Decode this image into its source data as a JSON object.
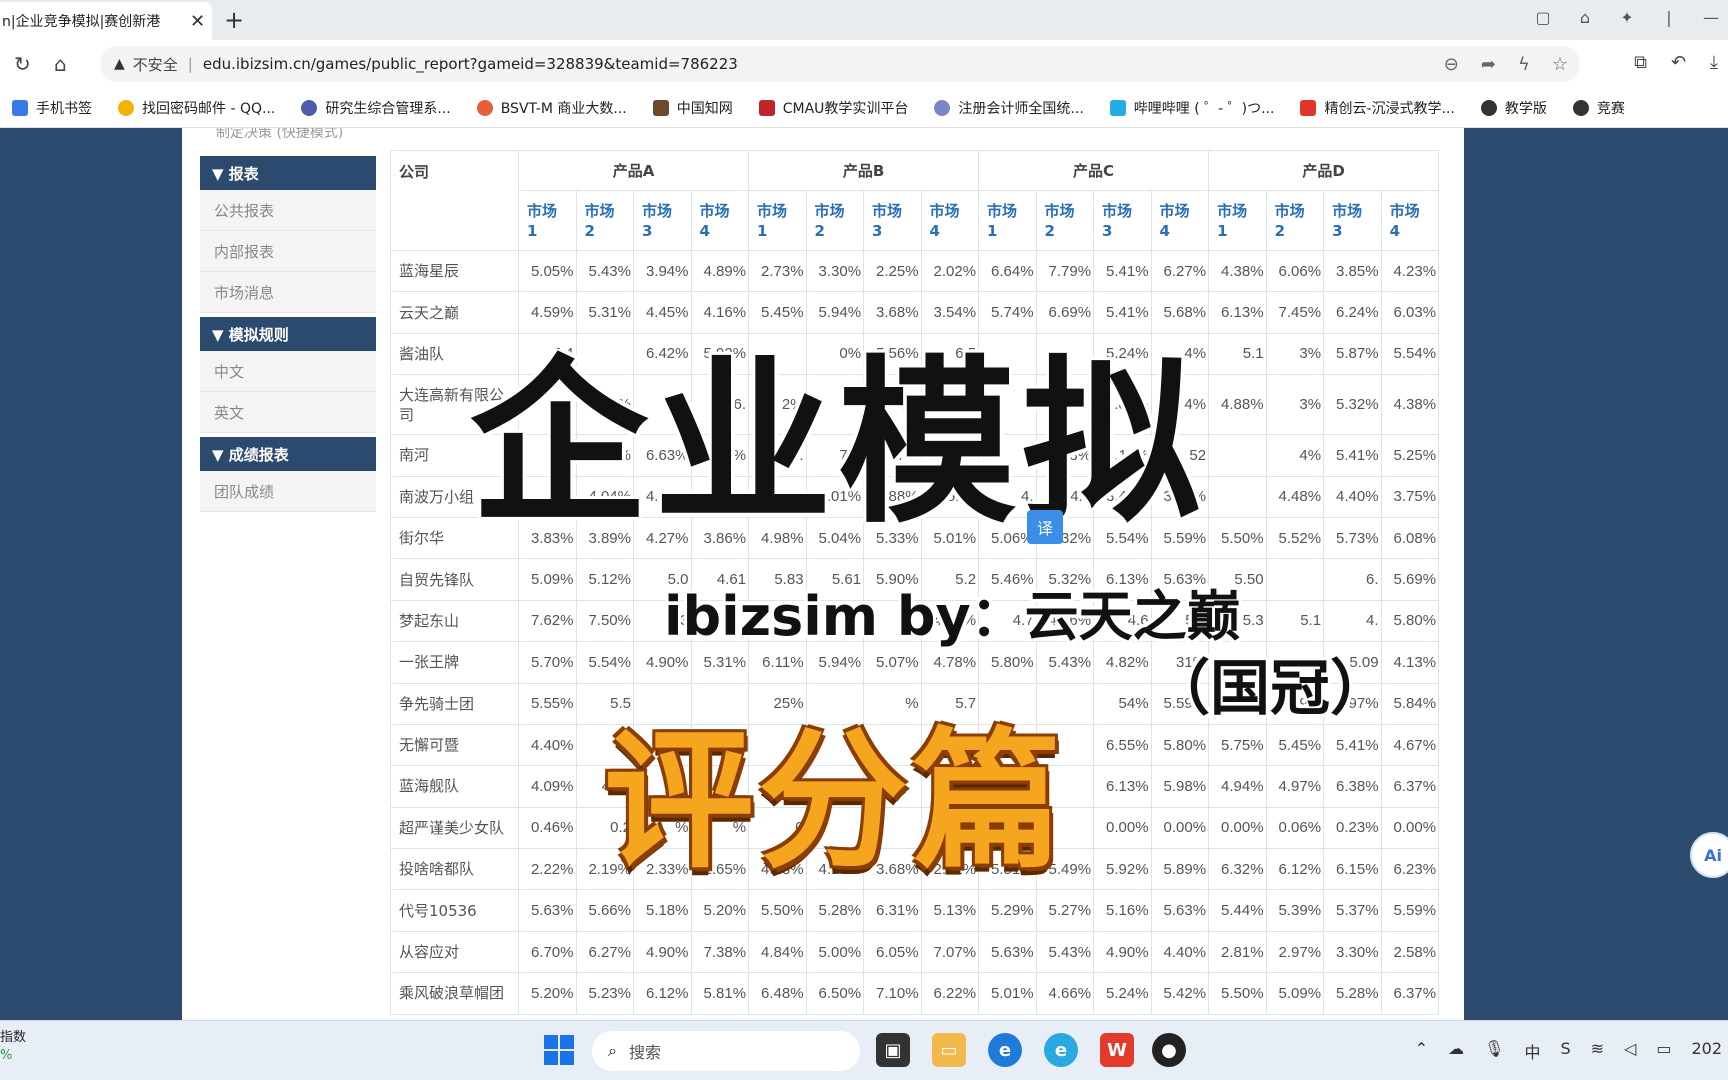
{
  "browser": {
    "tab_title": "n|企业竞争模拟|赛创新港",
    "tab_close": "✕",
    "new_tab": "+",
    "insecure_label": "不安全",
    "url": "edu.ibizsim.cn/games/public_report?gameid=328839&teamid=786223",
    "bookmarks": [
      "手机书签",
      "找回密码邮件 - QQ...",
      "研究生综合管理系...",
      "BSVT-M 商业大数...",
      "中国知网",
      "CMAU教学实训平台",
      "注册会计师全国统...",
      "哔哩哔哩 ( ゜- ゜)つ...",
      "精创云-沉浸式教学...",
      "教学版",
      "竞赛"
    ]
  },
  "sidebar": {
    "cut_item": "制定决策 (快捷模式)",
    "sections": [
      {
        "title": "▼ 报表",
        "items": [
          "公共报表",
          "内部报表",
          "市场消息"
        ]
      },
      {
        "title": "▼ 模拟规则",
        "items": [
          "中文",
          "英文"
        ]
      },
      {
        "title": "▼ 成绩报表",
        "items": [
          "团队成绩"
        ]
      }
    ]
  },
  "table": {
    "corner": "公司",
    "products": [
      "产品A",
      "产品B",
      "产品C",
      "产品D"
    ],
    "markets": [
      "市场\n1",
      "市场\n2",
      "市场\n3",
      "市场\n4"
    ],
    "rows": [
      {
        "company": "蓝海星辰",
        "values": [
          "5.05%",
          "5.43%",
          "3.94%",
          "4.89%",
          "2.73%",
          "3.30%",
          "2.25%",
          "2.02%",
          "6.64%",
          "7.79%",
          "5.41%",
          "6.27%",
          "4.38%",
          "6.06%",
          "3.85%",
          "4.23%"
        ]
      },
      {
        "company": "云天之巅",
        "values": [
          "4.59%",
          "5.31%",
          "4.45%",
          "4.16%",
          "5.45%",
          "5.94%",
          "3.68%",
          "3.54%",
          "5.74%",
          "6.69%",
          "5.41%",
          "5.68%",
          "6.13%",
          "7.45%",
          "6.24%",
          "6.03%"
        ]
      },
      {
        "company": "酱油队",
        "values": [
          "5.4",
          "",
          "6.42%",
          "5.92%",
          "",
          "0%",
          "5.56%",
          "6.5",
          "",
          "",
          "5.24%",
          "4%",
          "5.1",
          "3%",
          "5.87%",
          "5.54%"
        ]
      },
      {
        "company": "大连高新有限公司",
        "values": [
          "2%",
          "5%",
          "7%",
          "6.",
          "2%",
          "",
          "6.43%",
          "",
          "",
          "",
          "4.86%",
          "4%",
          "4.88%",
          "3%",
          "5.32%",
          "4.38%"
        ]
      },
      {
        "company": "南河",
        "values": [
          "%",
          "9%",
          "6.63%",
          "6.43%",
          "6.",
          "7%",
          "7.17%",
          "1",
          "3",
          "3%",
          "4.18%",
          "52",
          "",
          "4%",
          "5.41%",
          "5.25%"
        ]
      },
      {
        "company": "南波万小组",
        "values": [
          "",
          "4.04%",
          "4.69%",
          "5.",
          "4.09%",
          "4.01%",
          "4.88%",
          "5.71",
          "4.",
          "4.2",
          "3.48%",
          "3.23%",
          "",
          "4.48%",
          "4.40%",
          "3.75%"
        ]
      },
      {
        "company": "街尔华",
        "values": [
          "3.83%",
          "3.89%",
          "4.27%",
          "3.86%",
          "4.98%",
          "5.04%",
          "5.33%",
          "5.01%",
          "5.06%",
          "5.32%",
          "5.54%",
          "5.59%",
          "5.50%",
          "5.52%",
          "5.73%",
          "6.08%"
        ]
      },
      {
        "company": "自贸先锋队",
        "values": [
          "5.09%",
          "5.12%",
          "5.0",
          "4.61",
          "5.83",
          "5.61",
          "5.90%",
          "5.2",
          "5.46%",
          "5.32%",
          "6.13%",
          "5.63%",
          "5.50",
          "",
          "6.",
          "5.69%"
        ]
      },
      {
        "company": "梦起东山",
        "values": [
          "7.62%",
          "7.50%",
          "6.3",
          "",
          "",
          "",
          "",
          "4.60%",
          "4.7",
          "4.66%",
          "4.6",
          "5.2",
          "5.3",
          "5.1",
          "4.",
          "5.80%"
        ]
      },
      {
        "company": "一张王牌",
        "values": [
          "5.70%",
          "5.54%",
          "4.90%",
          "5.31%",
          "6.11%",
          "5.94%",
          "5.07%",
          "4.78%",
          "5.80%",
          "5.43%",
          "4.82%",
          "31%",
          "",
          "",
          "5.09",
          "4.13%"
        ]
      },
      {
        "company": "争先骑士团",
        "values": [
          "5.55%",
          "5.5",
          "",
          "",
          "25%",
          "",
          "%",
          "5.7",
          "",
          "",
          "54%",
          "5.59%",
          "4.94%",
          "4.79%",
          "4.97%",
          "5.84%"
        ]
      },
      {
        "company": "无懈可暨",
        "values": [
          "4.40%",
          "4",
          "",
          "",
          "",
          "",
          "",
          "",
          "",
          "",
          "6.55%",
          "5.80%",
          "5.75%",
          "5.45%",
          "5.41%",
          "4.67%"
        ]
      },
      {
        "company": "蓝海舰队",
        "values": [
          "4.09%",
          "4.12",
          "",
          "",
          "",
          "",
          "",
          "9.5",
          "",
          "",
          "6.13%",
          "5.98%",
          "4.94%",
          "4.97%",
          "6.38%",
          "6.37%"
        ]
      },
      {
        "company": "超严谨美少女队",
        "values": [
          "0.46%",
          "0.2",
          "%",
          "%",
          "0",
          "",
          "",
          "",
          "",
          "",
          "0.00%",
          "0.00%",
          "0.00%",
          "0.06%",
          "0.23%",
          "0.00%"
        ]
      },
      {
        "company": "投啥啥都队",
        "values": [
          "2.22%",
          "2.19%",
          "2.33%",
          "1.65%",
          "4.28%",
          "4.19%",
          "3.68%",
          "2.91%",
          "5.51%",
          "5.49%",
          "5.92%",
          "5.89%",
          "6.32%",
          "6.12%",
          "6.15%",
          "6.23%"
        ]
      },
      {
        "company": "代号10536",
        "values": [
          "5.63%",
          "5.66%",
          "5.18%",
          "5.20%",
          "5.50%",
          "5.28%",
          "6.31%",
          "5.13%",
          "5.29%",
          "5.27%",
          "5.16%",
          "5.63%",
          "5.44%",
          "5.39%",
          "5.37%",
          "5.59%"
        ]
      },
      {
        "company": "从容应对",
        "values": [
          "6.70%",
          "6.27%",
          "4.90%",
          "7.38%",
          "4.84%",
          "5.00%",
          "6.05%",
          "7.07%",
          "5.63%",
          "5.43%",
          "4.90%",
          "4.40%",
          "2.81%",
          "2.97%",
          "3.30%",
          "2.58%"
        ]
      },
      {
        "company": "乘风破浪草帽团",
        "values": [
          "5.20%",
          "5.23%",
          "6.12%",
          "5.81%",
          "6.48%",
          "6.50%",
          "7.10%",
          "6.22%",
          "5.01%",
          "4.66%",
          "5.24%",
          "5.42%",
          "5.50%",
          "5.09%",
          "5.28%",
          "6.37%"
        ]
      }
    ]
  },
  "overlay": {
    "title": "企业模拟",
    "byline": "ibizsim by：云天之巅",
    "byline2": "（国冠）",
    "subtitle": "评分篇",
    "translate": "译",
    "ai": "Ai"
  },
  "taskbar": {
    "left_label": "指数",
    "left_pct": "%",
    "search_placeholder": "搜索",
    "clock": "202"
  }
}
